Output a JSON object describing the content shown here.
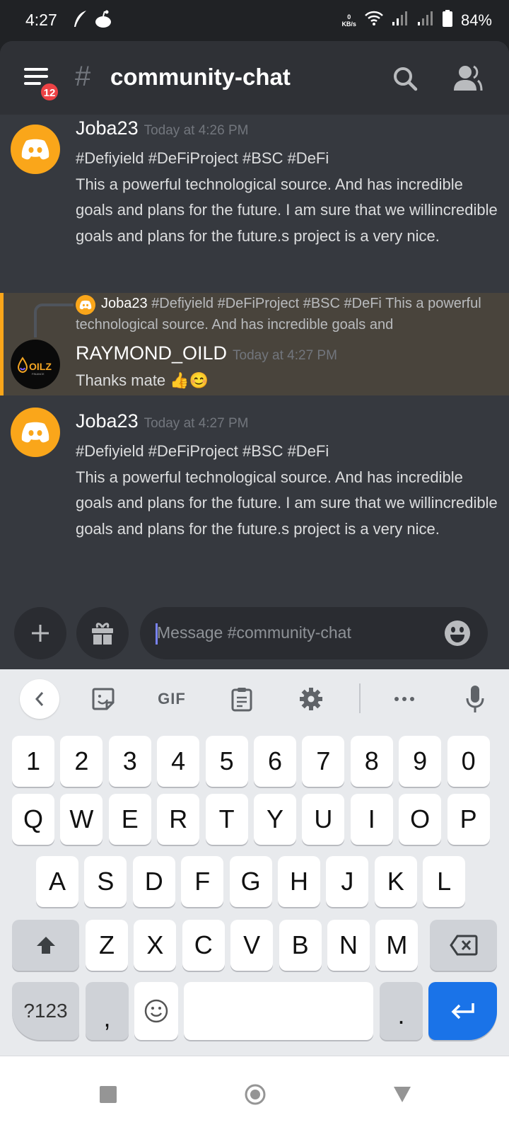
{
  "status_bar": {
    "time": "4:27",
    "left_icons": [
      "feather-icon",
      "reddit-icon"
    ],
    "network_speed_value": "0",
    "network_speed_unit": "KB/s",
    "battery_percent": "84%"
  },
  "header": {
    "unread_badge": "12",
    "channel_prefix": "#",
    "channel_name": "community-chat"
  },
  "messages": [
    {
      "author": "Joba23",
      "timestamp": "Today at 4:26 PM",
      "text": "#Defiyield #DeFiProject #BSC #DeFi\nThis a powerful technological source. And has incredible goals and plans for the future. I am sure that we willincredible goals and plans for the future.s project is a very nice."
    },
    {
      "reply_to": {
        "author": "Joba23",
        "preview": "#Defiyield #DeFiProject #BSC #DeFi This a powerful technological source. And has incredible goals and"
      },
      "author": "RAYMOND_OILD",
      "avatar_text": "OILZ",
      "avatar_subtext": "FINANCE",
      "timestamp": "Today at 4:27 PM",
      "text": "Thanks mate 👍😊",
      "highlighted": true
    },
    {
      "author": "Joba23",
      "timestamp": "Today at 4:27 PM",
      "text": "#Defiyield #DeFiProject #BSC #DeFi\nThis a powerful technological source. And has incredible goals and plans for the future. I am sure that we willincredible goals and plans for the future.s project is a very nice."
    }
  ],
  "composer": {
    "placeholder": "Message #community-chat",
    "value": ""
  },
  "keyboard": {
    "toolbar": {
      "gif_label": "GIF",
      "items": [
        "back-icon",
        "sticker-icon",
        "gif",
        "clipboard-icon",
        "settings-icon",
        "more-icon",
        "microphone-icon"
      ]
    },
    "rows": [
      [
        "1",
        "2",
        "3",
        "4",
        "5",
        "6",
        "7",
        "8",
        "9",
        "0"
      ],
      [
        "Q",
        "W",
        "E",
        "R",
        "T",
        "Y",
        "U",
        "I",
        "O",
        "P"
      ],
      [
        "A",
        "S",
        "D",
        "F",
        "G",
        "H",
        "J",
        "K",
        "L"
      ],
      [
        "Z",
        "X",
        "C",
        "V",
        "B",
        "N",
        "M"
      ]
    ],
    "symbols_label": "?123",
    "comma_label": ",",
    "period_label": "."
  },
  "colors": {
    "accent_orange": "#faa61a",
    "mention_highlight": "#49443c",
    "badge_red": "#ed4245",
    "enter_blue": "#1a73e8",
    "caret": "#7983f5"
  }
}
